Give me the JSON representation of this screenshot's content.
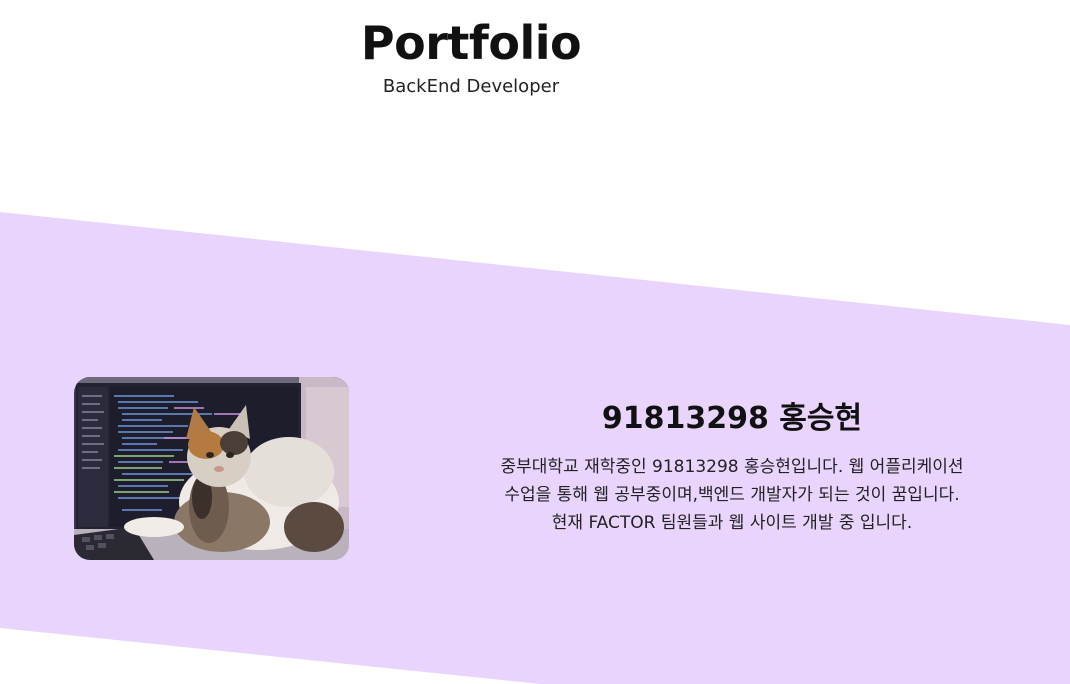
{
  "header": {
    "title": "Portfolio",
    "subtitle": "BackEnd Developer"
  },
  "theme": {
    "background": "#ffffff",
    "band_color": "#e8d4fd",
    "text_color": "#111111"
  },
  "profile": {
    "image_icon": "cat-on-laptop-photo",
    "name": "91813298 홍승현",
    "description": "중부대학교 재학중인 91813298 홍승현입니다. 웹 어플리케이션 수업을 통해 웹 공부중이며,백엔드 개발자가 되는 것이 꿈입니다. 현재 FACTOR 팀원들과 웹 사이트 개발 중 입니다."
  }
}
